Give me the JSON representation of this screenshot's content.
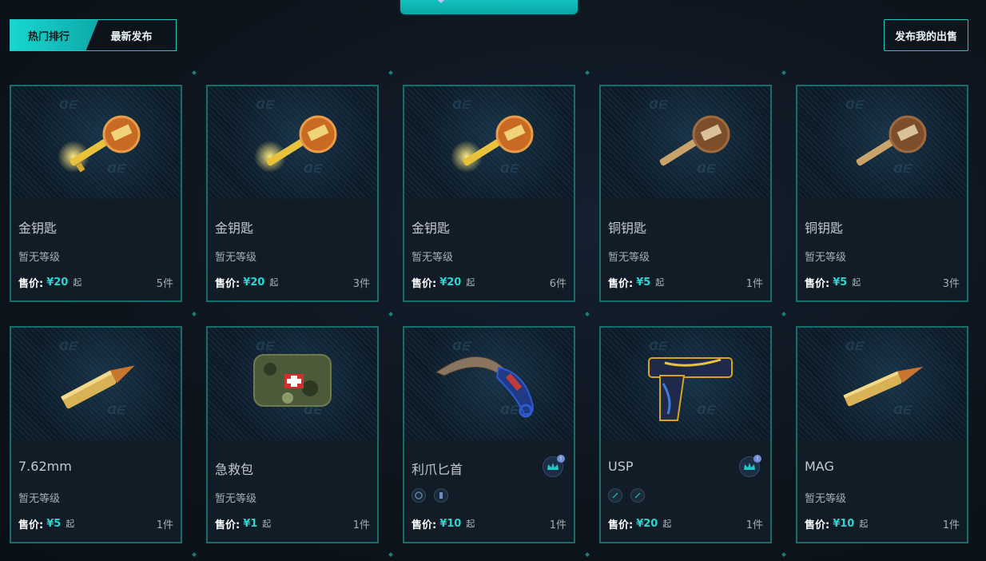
{
  "tabs": {
    "hot": "热门排行",
    "newest": "最新发布"
  },
  "header": {
    "publish_label": "发布我的出售"
  },
  "watermark": "ᗡᗴ",
  "price_label": "售价:",
  "qi_label": "起",
  "items": [
    {
      "name": "金钥匙",
      "grade": "暂无等级",
      "price": "¥20",
      "count": "5件",
      "icon": "gold-key-icon"
    },
    {
      "name": "金钥匙",
      "grade": "暂无等级",
      "price": "¥20",
      "count": "3件",
      "icon": "gold-key-icon"
    },
    {
      "name": "金钥匙",
      "grade": "暂无等级",
      "price": "¥20",
      "count": "6件",
      "icon": "gold-key-icon"
    },
    {
      "name": "铜钥匙",
      "grade": "暂无等级",
      "price": "¥5",
      "count": "1件",
      "icon": "copper-key-icon"
    },
    {
      "name": "铜钥匙",
      "grade": "暂无等级",
      "price": "¥5",
      "count": "3件",
      "icon": "copper-key-icon"
    },
    {
      "name": "7.62mm",
      "grade": "暂无等级",
      "price": "¥5",
      "count": "1件",
      "icon": "bullet-762-icon"
    },
    {
      "name": "急救包",
      "grade": "暂无等级",
      "price": "¥1",
      "count": "1件",
      "icon": "first-aid-kit-icon"
    },
    {
      "name": "利爪匕首",
      "price": "¥10",
      "count": "1件",
      "icon": "karambit-knife-icon",
      "has_crown": true
    },
    {
      "name": "USP",
      "price": "¥20",
      "count": "1件",
      "icon": "usp-pistol-icon",
      "has_crown": true
    },
    {
      "name": "MAG",
      "grade": "暂无等级",
      "price": "¥10",
      "count": "1件",
      "icon": "bullet-mag-icon"
    }
  ],
  "colors": {
    "accent": "#1ec9c3",
    "price": "#21d9d2",
    "card_border": "#186c6a",
    "background": "#0d141c"
  }
}
